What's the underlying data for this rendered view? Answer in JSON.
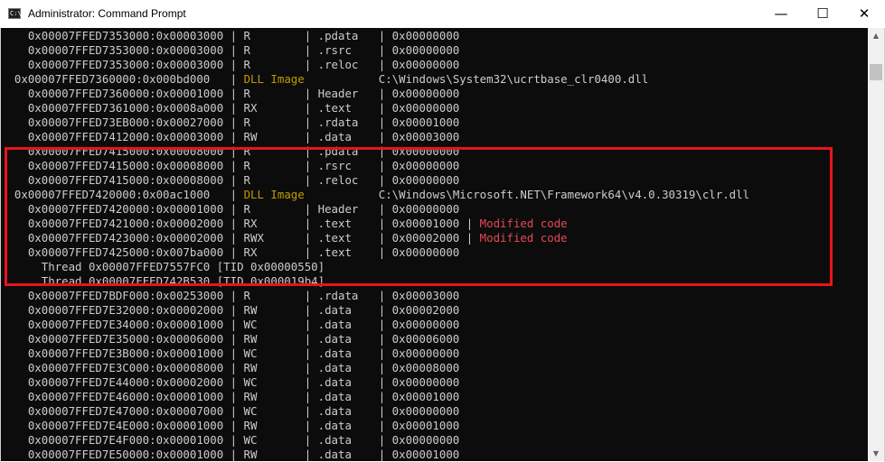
{
  "window": {
    "title": "Administrator: Command Prompt",
    "icon_glyph": "C:\\",
    "minimize": "—",
    "maximize": "☐",
    "close": "✕"
  },
  "scrollbar": {
    "up_arrow": "▲",
    "down_arrow": "▼"
  },
  "console": {
    "lines": [
      [
        {
          "t": "    0x00007FFED7353000:0x00003000 | R        | .pdata   | 0x00000000"
        }
      ],
      [
        {
          "t": "    0x00007FFED7353000:0x00003000 | R        | .rsrc    | 0x00000000"
        }
      ],
      [
        {
          "t": "    0x00007FFED7353000:0x00003000 | R        | .reloc   | 0x00000000"
        }
      ],
      [
        {
          "t": "  0x00007FFED7360000:0x000bd000   | "
        },
        {
          "t": "DLL Image",
          "c": "y"
        },
        {
          "t": "           C:\\Windows\\System32\\ucrtbase_clr0400.dll"
        }
      ],
      [
        {
          "t": "    0x00007FFED7360000:0x00001000 | R        | Header   | 0x00000000"
        }
      ],
      [
        {
          "t": "    0x00007FFED7361000:0x0008a000 | RX       | .text    | 0x00000000"
        }
      ],
      [
        {
          "t": "    0x00007FFED73EB000:0x00027000 | R        | .rdata   | 0x00001000"
        }
      ],
      [
        {
          "t": "    0x00007FFED7412000:0x00003000 | RW       | .data    | 0x00003000"
        }
      ],
      [
        {
          "t": "    0x00007FFED7415000:0x00008000 | R        | .pdata   | 0x00000000"
        }
      ],
      [
        {
          "t": "    0x00007FFED7415000:0x00008000 | R        | .rsrc    | 0x00000000"
        }
      ],
      [
        {
          "t": "    0x00007FFED7415000:0x00008000 | R        | .reloc   | 0x00000000"
        }
      ],
      [
        {
          "t": "  0x00007FFED7420000:0x00ac1000   | "
        },
        {
          "t": "DLL Image",
          "c": "y"
        },
        {
          "t": "           C:\\Windows\\Microsoft.NET\\Framework64\\v4.0.30319\\clr.dll"
        }
      ],
      [
        {
          "t": "    0x00007FFED7420000:0x00001000 | R        | Header   | 0x00000000"
        }
      ],
      [
        {
          "t": "    0x00007FFED7421000:0x00002000 | RX       | .text    | 0x00001000 | "
        },
        {
          "t": "Modified code",
          "c": "r"
        }
      ],
      [
        {
          "t": "    0x00007FFED7423000:0x00002000 | RWX      | .text    | 0x00002000 | "
        },
        {
          "t": "Modified code",
          "c": "r"
        }
      ],
      [
        {
          "t": "    0x00007FFED7425000:0x007ba000 | RX       | .text    | 0x00000000"
        }
      ],
      [
        {
          "t": "      Thread 0x00007FFED7557FC0 [TID 0x00000550]"
        }
      ],
      [
        {
          "t": "      Thread 0x00007FFED742B530 [TID 0x000019b4]"
        }
      ],
      [
        {
          "t": "    0x00007FFED7BDF000:0x00253000 | R        | .rdata   | 0x00003000"
        }
      ],
      [
        {
          "t": "    0x00007FFED7E32000:0x00002000 | RW       | .data    | 0x00002000"
        }
      ],
      [
        {
          "t": "    0x00007FFED7E34000:0x00001000 | WC       | .data    | 0x00000000"
        }
      ],
      [
        {
          "t": "    0x00007FFED7E35000:0x00006000 | RW       | .data    | 0x00006000"
        }
      ],
      [
        {
          "t": "    0x00007FFED7E3B000:0x00001000 | WC       | .data    | 0x00000000"
        }
      ],
      [
        {
          "t": "    0x00007FFED7E3C000:0x00008000 | RW       | .data    | 0x00008000"
        }
      ],
      [
        {
          "t": "    0x00007FFED7E44000:0x00002000 | WC       | .data    | 0x00000000"
        }
      ],
      [
        {
          "t": "    0x00007FFED7E46000:0x00001000 | RW       | .data    | 0x00001000"
        }
      ],
      [
        {
          "t": "    0x00007FFED7E47000:0x00007000 | WC       | .data    | 0x00000000"
        }
      ],
      [
        {
          "t": "    0x00007FFED7E4E000:0x00001000 | RW       | .data    | 0x00001000"
        }
      ],
      [
        {
          "t": "    0x00007FFED7E4F000:0x00001000 | WC       | .data    | 0x00000000"
        }
      ],
      [
        {
          "t": "    0x00007FFED7E50000:0x00001000 | RW       | .data    | 0x00001000"
        }
      ]
    ]
  },
  "colors": {
    "console_bg": "#0c0c0c",
    "console_text": "#cccccc",
    "dll_image_label": "#c19c00",
    "modified_code_label": "#e74856",
    "highlight_border": "#e8141c"
  }
}
